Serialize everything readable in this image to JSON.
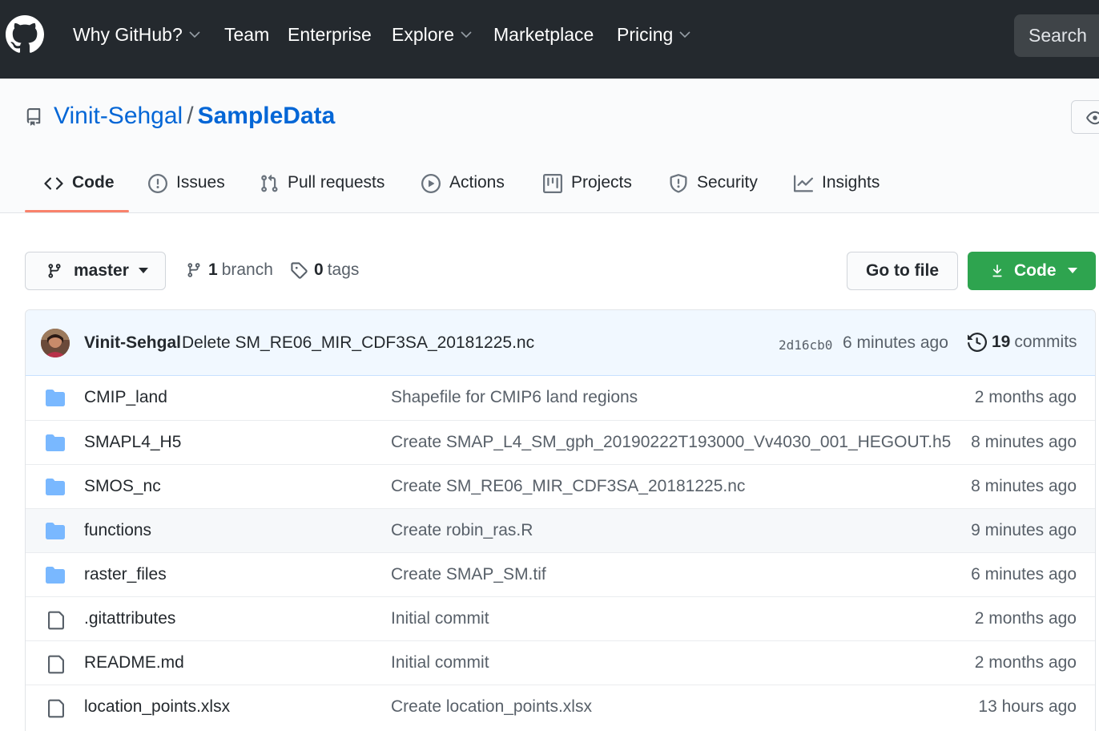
{
  "colors": {
    "header_bg": "#24292e",
    "link_blue": "#0366d6",
    "green_button": "#2ea44f",
    "tab_underline": "#f9826c",
    "folder_blue": "#79b8ff"
  },
  "header": {
    "logo_icon": "github-octocat-icon",
    "nav": [
      {
        "label": "Why GitHub?",
        "dropdown": true
      },
      {
        "label": "Team",
        "dropdown": false
      },
      {
        "label": "Enterprise",
        "dropdown": false
      },
      {
        "label": "Explore",
        "dropdown": true
      },
      {
        "label": "Marketplace",
        "dropdown": false
      },
      {
        "label": "Pricing",
        "dropdown": true
      }
    ],
    "search_placeholder": "Search"
  },
  "repo": {
    "owner": "Vinit-Sehgal",
    "separator": "/",
    "name": "SampleData"
  },
  "tabs": [
    {
      "label": "Code",
      "icon": "code-icon",
      "selected": true
    },
    {
      "label": "Issues",
      "icon": "issue-icon",
      "selected": false
    },
    {
      "label": "Pull requests",
      "icon": "pull-request-icon",
      "selected": false
    },
    {
      "label": "Actions",
      "icon": "play-icon",
      "selected": false
    },
    {
      "label": "Projects",
      "icon": "project-icon",
      "selected": false
    },
    {
      "label": "Security",
      "icon": "shield-icon",
      "selected": false
    },
    {
      "label": "Insights",
      "icon": "graph-icon",
      "selected": false
    }
  ],
  "branch_bar": {
    "branch": "master",
    "branches_count": "1",
    "branches_label": "branch",
    "tags_count": "0",
    "tags_label": "tags",
    "go_to_file": "Go to file",
    "code_button": "Code"
  },
  "latest_commit": {
    "author": "Vinit-Sehgal",
    "message": "Delete SM_RE06_MIR_CDF3SA_20181225.nc",
    "sha": "2d16cb0",
    "time": "6 minutes ago",
    "commits_count": "19",
    "commits_label": "commits"
  },
  "files": [
    {
      "name": "CMIP_land",
      "type": "folder",
      "message": "Shapefile for CMIP6 land regions",
      "age": "2 months ago"
    },
    {
      "name": "SMAPL4_H5",
      "type": "folder",
      "message": "Create SMAP_L4_SM_gph_20190222T193000_Vv4030_001_HEGOUT.h5",
      "age": "8 minutes ago"
    },
    {
      "name": "SMOS_nc",
      "type": "folder",
      "message": "Create SM_RE06_MIR_CDF3SA_20181225.nc",
      "age": "8 minutes ago"
    },
    {
      "name": "functions",
      "type": "folder",
      "message": "Create robin_ras.R",
      "age": "9 minutes ago"
    },
    {
      "name": "raster_files",
      "type": "folder",
      "message": "Create SMAP_SM.tif",
      "age": "6 minutes ago"
    },
    {
      "name": ".gitattributes",
      "type": "file",
      "message": "Initial commit",
      "age": "2 months ago"
    },
    {
      "name": "README.md",
      "type": "file",
      "message": "Initial commit",
      "age": "2 months ago"
    },
    {
      "name": "location_points.xlsx",
      "type": "file",
      "message": "Create location_points.xlsx",
      "age": "13 hours ago"
    }
  ]
}
